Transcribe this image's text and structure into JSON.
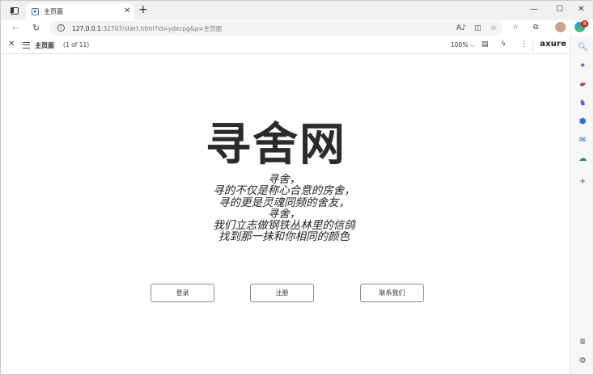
{
  "browser": {
    "tab_title": "主页面",
    "url_host": "127.0.0.1",
    "url_rest": ":32767/start.html?id=ydxcpg&p=主页面",
    "badge_count": "8"
  },
  "axure_toolbar": {
    "page_name": "主页面",
    "page_count": "(1 of 11)",
    "zoom": "100% ⌵",
    "logo": "axure"
  },
  "page": {
    "title": "寻舍网",
    "poem_lines": [
      "寻舍，",
      "寻的不仅是称心合意的房舍，",
      "寻的更是灵魂同频的舍友，",
      "寻舍，",
      "我们立志做钢铁丛林里的信鸽",
      "找到那一抹和你相同的颜色"
    ],
    "buttons": {
      "login": "登录",
      "register": "注册",
      "contact": "联系我们"
    }
  },
  "colors": {
    "desktop": "#3f7fa6",
    "tab_bar": "#f0f0f0",
    "accent": "#4a6fd0"
  }
}
